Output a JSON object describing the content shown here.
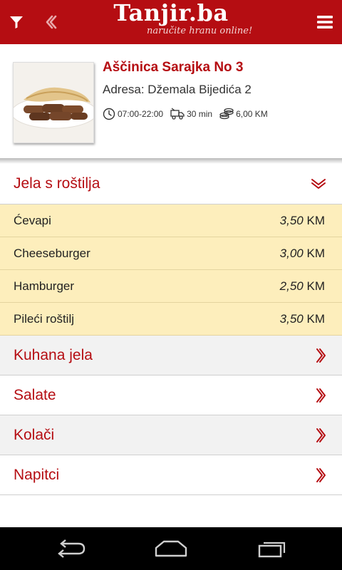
{
  "header": {
    "logo_title": "Tanjir.ba",
    "logo_subtitle": "naručite hranu online!",
    "background": "#b50d12"
  },
  "restaurant": {
    "name": "Aščinica Sarajka No 3",
    "address": "Adresa: Džemala Bijedića 2",
    "hours": "07:00-22:00",
    "delivery_time": "30 min",
    "min_order": "6,00 KM",
    "photo": "cevapi-plate"
  },
  "categories": [
    {
      "label": "Jela s roštilja",
      "expanded": true,
      "items": [
        {
          "name": "Ćevapi",
          "price": "3,50",
          "currency": "KM"
        },
        {
          "name": "Cheeseburger",
          "price": "3,00",
          "currency": "KM"
        },
        {
          "name": "Hamburger",
          "price": "2,50",
          "currency": "KM"
        },
        {
          "name": "Pileći roštilj",
          "price": "3,50",
          "currency": "KM"
        }
      ]
    },
    {
      "label": "Kuhana jela",
      "expanded": false
    },
    {
      "label": "Salate",
      "expanded": false
    },
    {
      "label": "Kolači",
      "expanded": false
    },
    {
      "label": "Napitci",
      "expanded": false
    }
  ],
  "icons": {
    "filter": "filter-icon",
    "back": "chevron-left-double-icon",
    "menu": "hamburger-menu-icon",
    "expanded": "chevron-down-double-icon",
    "collapsed": "chevron-right-double-icon"
  },
  "colors": {
    "accent": "#b50d12",
    "item_background": "#fdeebc",
    "category_gray": "#f2f2f2"
  }
}
